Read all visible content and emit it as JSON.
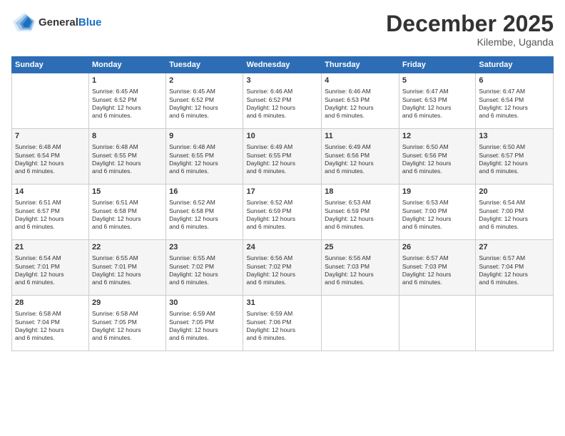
{
  "logo": {
    "general": "General",
    "blue": "Blue"
  },
  "header": {
    "month": "December 2025",
    "location": "Kilembe, Uganda"
  },
  "days_of_week": [
    "Sunday",
    "Monday",
    "Tuesday",
    "Wednesday",
    "Thursday",
    "Friday",
    "Saturday"
  ],
  "weeks": [
    [
      {
        "num": "",
        "info": ""
      },
      {
        "num": "1",
        "info": "Sunrise: 6:45 AM\nSunset: 6:52 PM\nDaylight: 12 hours\nand 6 minutes."
      },
      {
        "num": "2",
        "info": "Sunrise: 6:45 AM\nSunset: 6:52 PM\nDaylight: 12 hours\nand 6 minutes."
      },
      {
        "num": "3",
        "info": "Sunrise: 6:46 AM\nSunset: 6:52 PM\nDaylight: 12 hours\nand 6 minutes."
      },
      {
        "num": "4",
        "info": "Sunrise: 6:46 AM\nSunset: 6:53 PM\nDaylight: 12 hours\nand 6 minutes."
      },
      {
        "num": "5",
        "info": "Sunrise: 6:47 AM\nSunset: 6:53 PM\nDaylight: 12 hours\nand 6 minutes."
      },
      {
        "num": "6",
        "info": "Sunrise: 6:47 AM\nSunset: 6:54 PM\nDaylight: 12 hours\nand 6 minutes."
      }
    ],
    [
      {
        "num": "7",
        "info": "Sunrise: 6:48 AM\nSunset: 6:54 PM\nDaylight: 12 hours\nand 6 minutes."
      },
      {
        "num": "8",
        "info": "Sunrise: 6:48 AM\nSunset: 6:55 PM\nDaylight: 12 hours\nand 6 minutes."
      },
      {
        "num": "9",
        "info": "Sunrise: 6:48 AM\nSunset: 6:55 PM\nDaylight: 12 hours\nand 6 minutes."
      },
      {
        "num": "10",
        "info": "Sunrise: 6:49 AM\nSunset: 6:55 PM\nDaylight: 12 hours\nand 6 minutes."
      },
      {
        "num": "11",
        "info": "Sunrise: 6:49 AM\nSunset: 6:56 PM\nDaylight: 12 hours\nand 6 minutes."
      },
      {
        "num": "12",
        "info": "Sunrise: 6:50 AM\nSunset: 6:56 PM\nDaylight: 12 hours\nand 6 minutes."
      },
      {
        "num": "13",
        "info": "Sunrise: 6:50 AM\nSunset: 6:57 PM\nDaylight: 12 hours\nand 6 minutes."
      }
    ],
    [
      {
        "num": "14",
        "info": "Sunrise: 6:51 AM\nSunset: 6:57 PM\nDaylight: 12 hours\nand 6 minutes."
      },
      {
        "num": "15",
        "info": "Sunrise: 6:51 AM\nSunset: 6:58 PM\nDaylight: 12 hours\nand 6 minutes."
      },
      {
        "num": "16",
        "info": "Sunrise: 6:52 AM\nSunset: 6:58 PM\nDaylight: 12 hours\nand 6 minutes."
      },
      {
        "num": "17",
        "info": "Sunrise: 6:52 AM\nSunset: 6:59 PM\nDaylight: 12 hours\nand 6 minutes."
      },
      {
        "num": "18",
        "info": "Sunrise: 6:53 AM\nSunset: 6:59 PM\nDaylight: 12 hours\nand 6 minutes."
      },
      {
        "num": "19",
        "info": "Sunrise: 6:53 AM\nSunset: 7:00 PM\nDaylight: 12 hours\nand 6 minutes."
      },
      {
        "num": "20",
        "info": "Sunrise: 6:54 AM\nSunset: 7:00 PM\nDaylight: 12 hours\nand 6 minutes."
      }
    ],
    [
      {
        "num": "21",
        "info": "Sunrise: 6:54 AM\nSunset: 7:01 PM\nDaylight: 12 hours\nand 6 minutes."
      },
      {
        "num": "22",
        "info": "Sunrise: 6:55 AM\nSunset: 7:01 PM\nDaylight: 12 hours\nand 6 minutes."
      },
      {
        "num": "23",
        "info": "Sunrise: 6:55 AM\nSunset: 7:02 PM\nDaylight: 12 hours\nand 6 minutes."
      },
      {
        "num": "24",
        "info": "Sunrise: 6:56 AM\nSunset: 7:02 PM\nDaylight: 12 hours\nand 6 minutes."
      },
      {
        "num": "25",
        "info": "Sunrise: 6:56 AM\nSunset: 7:03 PM\nDaylight: 12 hours\nand 6 minutes."
      },
      {
        "num": "26",
        "info": "Sunrise: 6:57 AM\nSunset: 7:03 PM\nDaylight: 12 hours\nand 6 minutes."
      },
      {
        "num": "27",
        "info": "Sunrise: 6:57 AM\nSunset: 7:04 PM\nDaylight: 12 hours\nand 6 minutes."
      }
    ],
    [
      {
        "num": "28",
        "info": "Sunrise: 6:58 AM\nSunset: 7:04 PM\nDaylight: 12 hours\nand 6 minutes."
      },
      {
        "num": "29",
        "info": "Sunrise: 6:58 AM\nSunset: 7:05 PM\nDaylight: 12 hours\nand 6 minutes."
      },
      {
        "num": "30",
        "info": "Sunrise: 6:59 AM\nSunset: 7:05 PM\nDaylight: 12 hours\nand 6 minutes."
      },
      {
        "num": "31",
        "info": "Sunrise: 6:59 AM\nSunset: 7:06 PM\nDaylight: 12 hours\nand 6 minutes."
      },
      {
        "num": "",
        "info": ""
      },
      {
        "num": "",
        "info": ""
      },
      {
        "num": "",
        "info": ""
      }
    ]
  ]
}
